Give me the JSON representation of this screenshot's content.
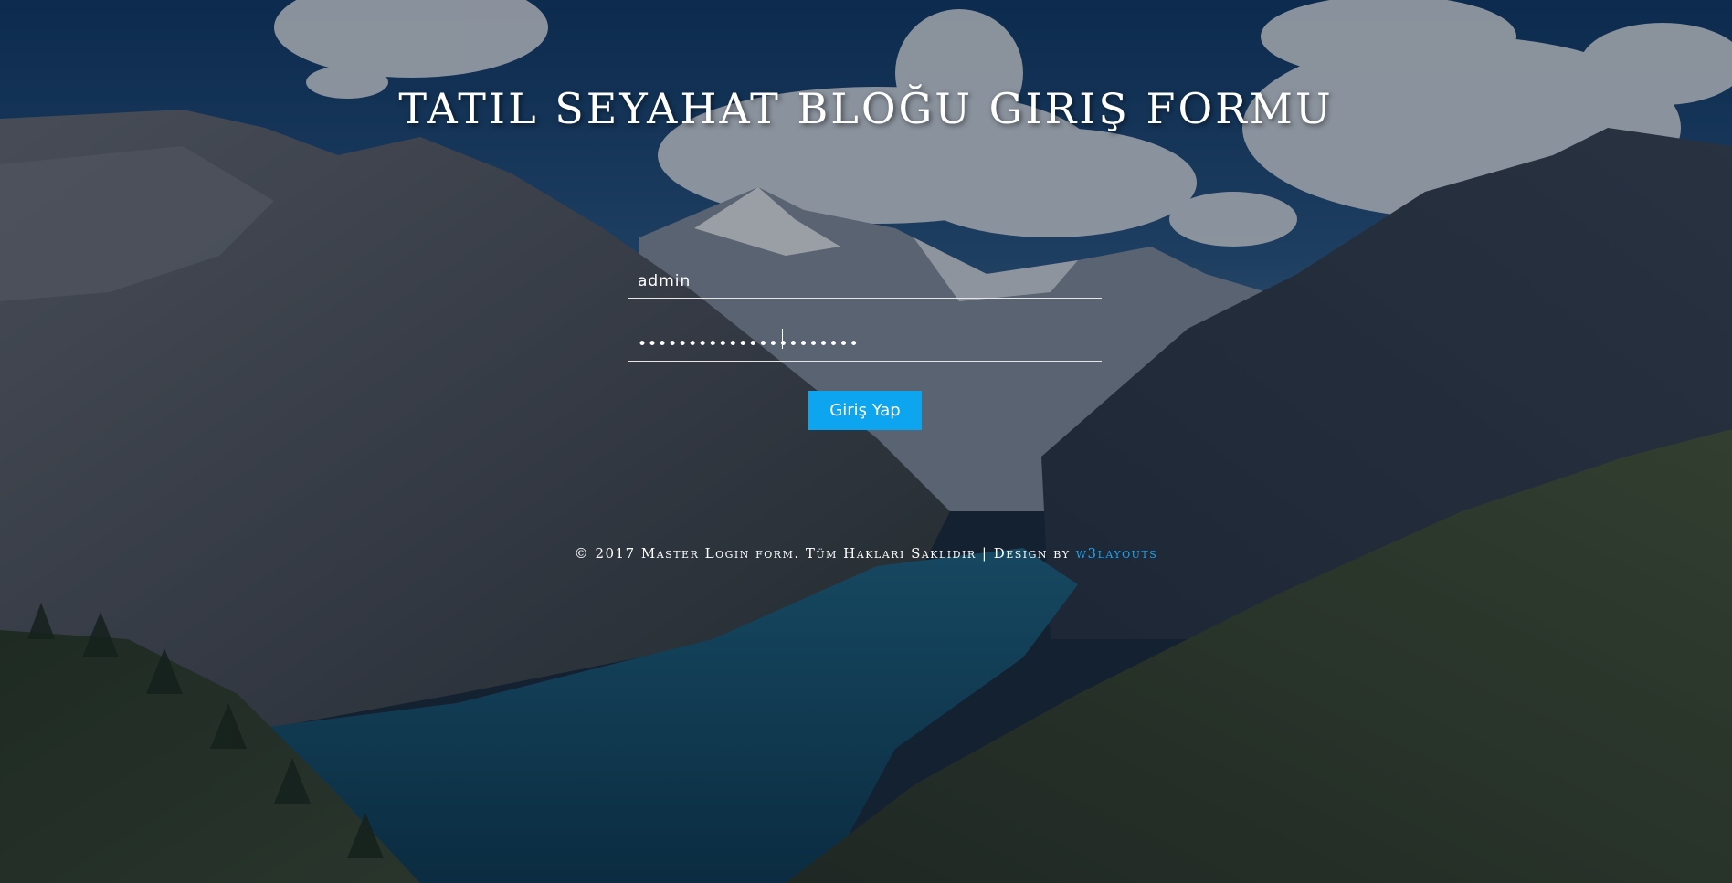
{
  "page": {
    "title": "TATIL SEYAHAT BLOĞU GIRIŞ FORMU"
  },
  "form": {
    "username_value": "admin",
    "password_value": "••••••••••••••••••••••",
    "submit_label": "Giriş Yap"
  },
  "footer": {
    "text": "© 2017 Master Login form. Tüm Hakları Saklıdır | Design by ",
    "link_label": "w3layouts",
    "link_color": "#1aa6f2"
  },
  "colors": {
    "button": "#0ea5f0",
    "text": "#ffffff"
  }
}
